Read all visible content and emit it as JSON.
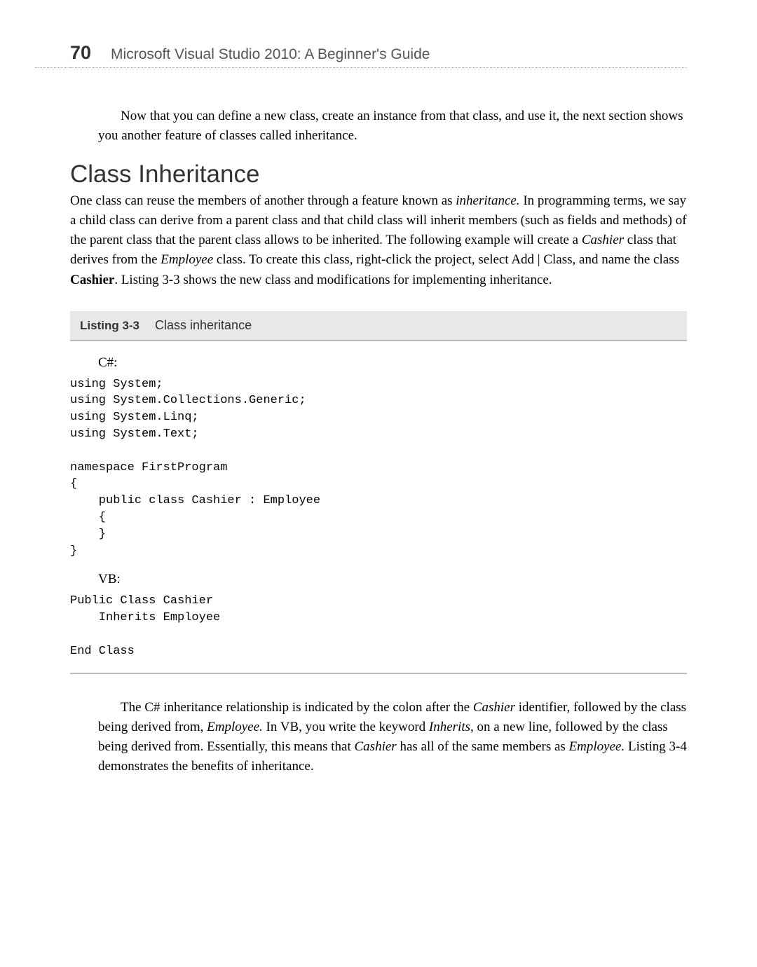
{
  "header": {
    "page_number": "70",
    "title": "Microsoft Visual Studio 2010: A Beginner's Guide"
  },
  "intro": "Now that you can define a new class, create an instance from that class, and use it, the next section shows you another feature of classes called inheritance.",
  "section": {
    "heading": "Class Inheritance",
    "body_pre": "One class can reuse the members of another through a feature known as ",
    "inheritance_em": "inheritance.",
    "body_mid1": " In programming terms, we say a child class can derive from a parent class and that child class will inherit members (such as fields and methods) of the parent class that the parent class allows to be inherited. The following example will create a ",
    "cashier_em": "Cashier",
    "body_mid2": " class that derives from the ",
    "employee_em": "Employee",
    "body_mid3": " class. To create this class, right-click the project, select Add | Class, and name the class ",
    "cashier_bold": "Cashier",
    "body_end": ". Listing 3-3 shows the new class and modifications for implementing inheritance."
  },
  "listing": {
    "label": "Listing 3-3",
    "caption": "Class inheritance"
  },
  "code": {
    "csharp_label": "C#:",
    "csharp": "using System;\nusing System.Collections.Generic;\nusing System.Linq;\nusing System.Text;\n\nnamespace FirstProgram\n{\n    public class Cashier : Employee\n    {\n    }\n}",
    "vb_label": "VB:",
    "vb": "Public Class Cashier\n    Inherits Employee\n\nEnd Class"
  },
  "closing": {
    "p1_pre": "The C# inheritance relationship is indicated by the colon after the ",
    "p1_cashier": "Cashier",
    "p1_mid1": " identifier, followed by the class being derived from, ",
    "p1_employee": "Employee.",
    "p1_mid2": " In VB, you write the keyword ",
    "p1_inherits": "Inherits,",
    "p1_mid3": " on a new line, followed by the class being derived from. Essentially, this means that ",
    "p1_cashier2": "Cashier",
    "p1_mid4": " has all of the same members as ",
    "p1_employee2": "Employee.",
    "p1_end": " Listing 3-4 demonstrates the benefits of inheritance."
  }
}
